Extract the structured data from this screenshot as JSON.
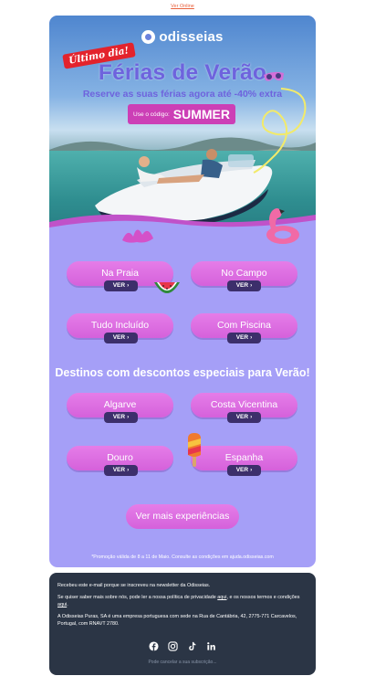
{
  "header": {
    "view_online": "Ver Online"
  },
  "brand": {
    "name": "odisseias"
  },
  "hero": {
    "badge": "Último dia!",
    "title": "Férias de Verão",
    "subtitle": "Reserve as suas férias agora até -40% extra",
    "code_label": "Use o código:",
    "code_value": "SUMMER"
  },
  "categories": [
    {
      "label": "Na Praia",
      "cta": "VER"
    },
    {
      "label": "No Campo",
      "cta": "VER"
    },
    {
      "label": "Tudo Incluído",
      "cta": "VER"
    },
    {
      "label": "Com Piscina",
      "cta": "VER"
    }
  ],
  "destinations": {
    "title": "Destinos com descontos especiais para Verão!",
    "items": [
      {
        "label": "Algarve",
        "cta": "VER"
      },
      {
        "label": "Costa Vicentina",
        "cta": "VER"
      },
      {
        "label": "Douro",
        "cta": "VER"
      },
      {
        "label": "Espanha",
        "cta": "VER"
      }
    ]
  },
  "more_button": "Ver mais experiências",
  "promo_note": "*Promoção válida de 8 a 11 de Maio. Consulte as condições em ajuda.odisseias.com",
  "footer": {
    "line1": "Recebeu este e-mail porque se inscreveu na newsletter da Odisseias.",
    "line2_pre": "Se quiser saber mais sobre nós, pode ler a nossa política de privacidade ",
    "line2_link1": "aqui",
    "line2_mid": ", e os nossos termos e condições ",
    "line2_link2": "aqui",
    "line2_end": ".",
    "line3": "A Odisseias Puras, SA é uma empresa portuguesa com sede na Rua de Cantábria, 42, 2775-771 Carcavelos, Portugal, com RNAVT 2780.",
    "cancel": "Pode cancelar a sua subscrição..."
  },
  "icons": [
    "facebook-icon",
    "instagram-icon",
    "tiktok-icon",
    "linkedin-icon"
  ],
  "colors": {
    "card_bg": "#a59ff7",
    "pill": "#d561db",
    "ver_badge": "#3c2f6b",
    "title": "#6e63dd",
    "footer_bg": "#2b3545",
    "link": "#e8603c"
  }
}
